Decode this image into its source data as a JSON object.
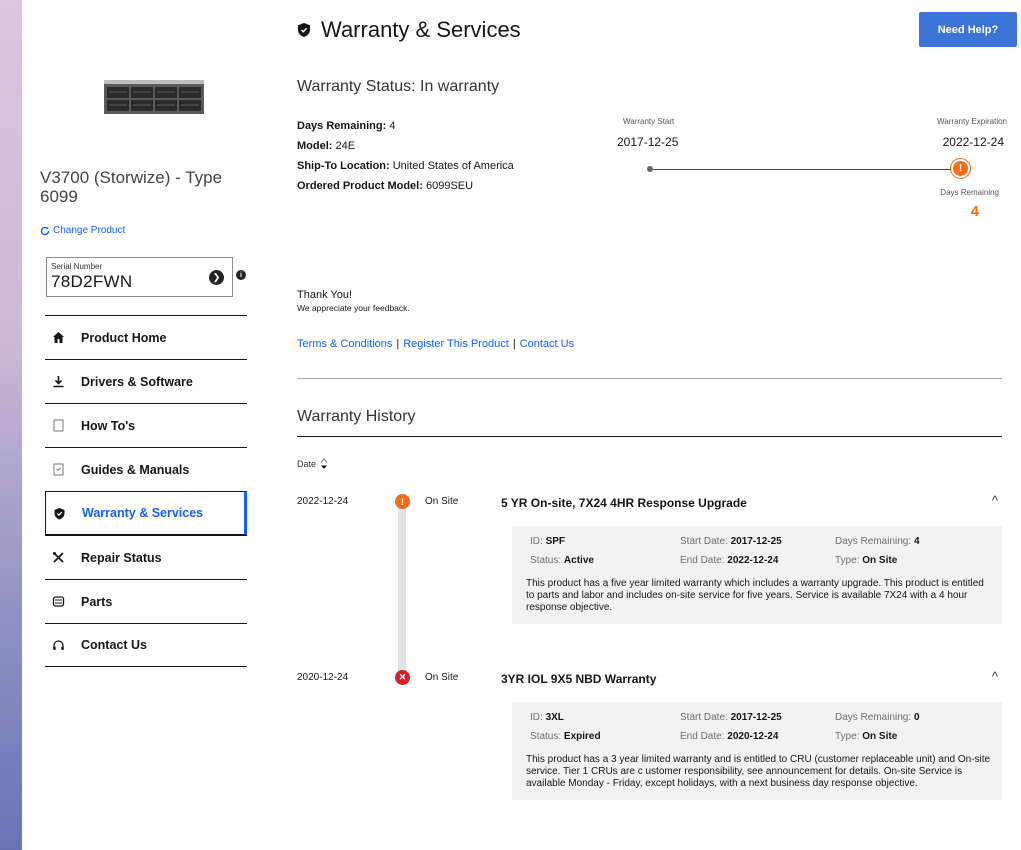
{
  "product": {
    "name": "V3700 (Storwize) - Type 6099",
    "change_label": "Change Product",
    "serial_label": "Serial Number",
    "serial_value": "78D2FWN"
  },
  "nav": [
    {
      "label": "Product Home",
      "icon": "home-icon",
      "active": false
    },
    {
      "label": "Drivers & Software",
      "icon": "download-icon",
      "active": false
    },
    {
      "label": "How To's",
      "icon": "document-icon",
      "active": false
    },
    {
      "label": "Guides & Manuals",
      "icon": "manual-icon",
      "active": false
    },
    {
      "label": "Warranty & Services",
      "icon": "shield-icon",
      "active": true
    },
    {
      "label": "Repair Status",
      "icon": "tools-icon",
      "active": false
    },
    {
      "label": "Parts",
      "icon": "parts-icon",
      "active": false
    },
    {
      "label": "Contact Us",
      "icon": "headset-icon",
      "active": false
    }
  ],
  "header": {
    "title": "Warranty & Services",
    "help_button": "Need Help?"
  },
  "warranty": {
    "status_title": "Warranty Status: In warranty",
    "days_remaining_label": "Days Remaining:",
    "days_remaining_value": "4",
    "model_label": "Model:",
    "model_value": "24E",
    "ship_label": "Ship-To Location:",
    "ship_value": "United States of America",
    "ordered_label": "Ordered Product Model:",
    "ordered_value": "6099SEU"
  },
  "timeline": {
    "start_label": "Warranty Start",
    "start_value": "2017-12-25",
    "exp_label": "Warranty Expiration",
    "exp_value": "2022-12-24",
    "days_label": "Days Remaining",
    "days_value": "4"
  },
  "feedback": {
    "title": "Thank You!",
    "subtitle": "We appreciate your feedback."
  },
  "links": {
    "terms": "Terms & Conditions",
    "register": "Register This Product",
    "contact": "Contact Us",
    "sep": "|"
  },
  "history": {
    "title": "Warranty History",
    "date_sort_label": "Date",
    "entries": [
      {
        "date": "2022-12-24",
        "status_icon": "warning-icon",
        "type": "On Site",
        "name": "5 YR On-site, 7X24 4HR Response Upgrade",
        "id_label": "ID:",
        "id": "SPF",
        "start_label": "Start Date:",
        "start": "2017-12-25",
        "days_label": "Days Remaining:",
        "days": "4",
        "status_label": "Status:",
        "status": "Active",
        "end_label": "End Date:",
        "end": "2022-12-24",
        "type_label": "Type:",
        "type_value": "On Site",
        "description": "This product has a five year limited warranty which includes a warranty upgrade. This product is entitled to parts and labor and includes on-site service for five years. Service is available 7X24 with a 4 hour response objective."
      },
      {
        "date": "2020-12-24",
        "status_icon": "error-icon",
        "type": "On Site",
        "name": "3YR IOL 9X5 NBD Warranty",
        "id_label": "ID:",
        "id": "3XL",
        "start_label": "Start Date:",
        "start": "2017-12-25",
        "days_label": "Days Remaining:",
        "days": "0",
        "status_label": "Status:",
        "status": "Expired",
        "end_label": "End Date:",
        "end": "2020-12-24",
        "type_label": "Type:",
        "type_value": "On Site",
        "description": "This product has a 3 year limited warranty and is entitled to CRU (customer replaceable unit) and On-site service. Tier 1 CRUs are c ustomer responsibility, see announcement for details. On-site Service is available Monday - Friday, except holidays, with a next business day response objective."
      }
    ]
  },
  "colors": {
    "accent": "#0f62fe",
    "warning": "#f56b16",
    "error": "#da1e28",
    "help_button": "#3b73d6"
  }
}
